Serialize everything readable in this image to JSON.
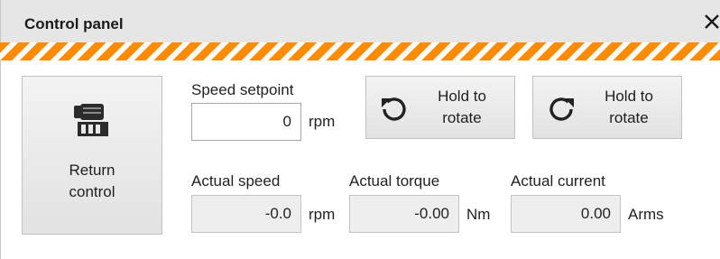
{
  "window": {
    "title": "Control panel",
    "close_icon": "close-icon",
    "accent_color": "#ff8c00"
  },
  "return_control": {
    "label": "Return\ncontrol",
    "icon": "motor-drive-icon"
  },
  "speed_setpoint": {
    "label": "Speed setpoint",
    "value": "0",
    "unit": "rpm"
  },
  "rotate_ccw": {
    "label": "Hold to\nrotate",
    "icon": "rotate-ccw-icon"
  },
  "rotate_cw": {
    "label": "Hold to\nrotate",
    "icon": "rotate-cw-icon"
  },
  "actual_speed": {
    "label": "Actual speed",
    "value": "-0.0",
    "unit": "rpm"
  },
  "actual_torque": {
    "label": "Actual torque",
    "value": "-0.00",
    "unit": "Nm"
  },
  "actual_current": {
    "label": "Actual current",
    "value": "0.00",
    "unit": "Arms"
  }
}
